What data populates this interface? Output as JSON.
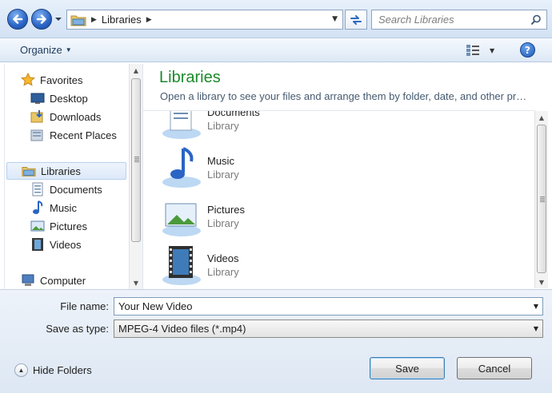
{
  "address_bar": {
    "breadcrumbs": [
      "Libraries"
    ],
    "search_placeholder": "Search Libraries"
  },
  "toolbar": {
    "organize_label": "Organize"
  },
  "nav": {
    "favorites": {
      "label": "Favorites",
      "items": [
        {
          "label": "Desktop",
          "icon": "desktop-icon"
        },
        {
          "label": "Downloads",
          "icon": "downloads-icon"
        },
        {
          "label": "Recent Places",
          "icon": "recent-places-icon"
        }
      ]
    },
    "libraries": {
      "label": "Libraries",
      "selected": true,
      "items": [
        {
          "label": "Documents",
          "icon": "documents-icon"
        },
        {
          "label": "Music",
          "icon": "music-icon"
        },
        {
          "label": "Pictures",
          "icon": "pictures-icon"
        },
        {
          "label": "Videos",
          "icon": "videos-icon"
        }
      ]
    },
    "computer": {
      "label": "Computer"
    }
  },
  "content": {
    "title": "Libraries",
    "subtitle": "Open a library to see your files and arrange them by folder, date, and other pr…",
    "items": [
      {
        "name": "Documents",
        "type": "Library",
        "icon": "documents-library-icon"
      },
      {
        "name": "Music",
        "type": "Library",
        "icon": "music-library-icon"
      },
      {
        "name": "Pictures",
        "type": "Library",
        "icon": "pictures-library-icon"
      },
      {
        "name": "Videos",
        "type": "Library",
        "icon": "videos-library-icon"
      }
    ]
  },
  "form": {
    "file_name_label": "File name:",
    "file_name_value": "Your New Video",
    "save_type_label": "Save as type:",
    "save_type_value": "MPEG-4 Video files (*.mp4)",
    "hide_folders_label": "Hide Folders",
    "save_label": "Save",
    "cancel_label": "Cancel"
  },
  "colors": {
    "title_green": "#1b8a2a",
    "accent_blue": "#2a64c5",
    "selection": "#dce9f9"
  }
}
